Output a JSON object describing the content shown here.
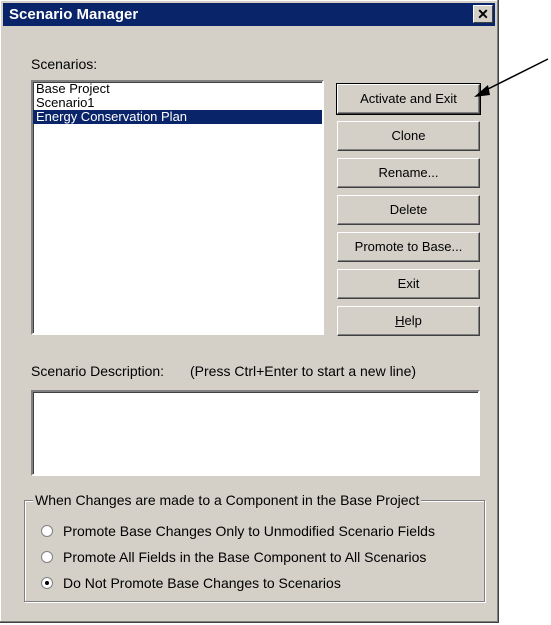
{
  "window": {
    "title": "Scenario Manager",
    "close_glyph": "✕"
  },
  "scenarios": {
    "label": "Scenarios:",
    "items": [
      {
        "label": "Base Project",
        "selected": false
      },
      {
        "label": "Scenario1",
        "selected": false
      },
      {
        "label": "Energy Conservation Plan",
        "selected": true
      }
    ]
  },
  "buttons": {
    "activate_exit": "Activate and Exit",
    "clone": "Clone",
    "rename": "Rename...",
    "delete": "Delete",
    "promote_base": "Promote to Base...",
    "exit": "Exit",
    "help_prefix": "",
    "help_mnemonic": "H",
    "help_rest": "elp"
  },
  "description": {
    "label": "Scenario Description:",
    "hint": "(Press Ctrl+Enter to start a new line)",
    "value": ""
  },
  "changes_group": {
    "legend": "When Changes are made to a Component in the Base Project",
    "options": [
      {
        "label": "Promote Base Changes Only to Unmodified Scenario Fields",
        "checked": false
      },
      {
        "label": "Promote All Fields in the Base Component to All Scenarios",
        "checked": false
      },
      {
        "label": "Do Not Promote Base Changes to Scenarios",
        "checked": true
      }
    ]
  },
  "colors": {
    "titlebar": "#0a246a",
    "dialog_bg": "#d4d0c8",
    "selection": "#0a246a"
  },
  "annotation": {
    "icon": "arrow-pointer-icon"
  }
}
